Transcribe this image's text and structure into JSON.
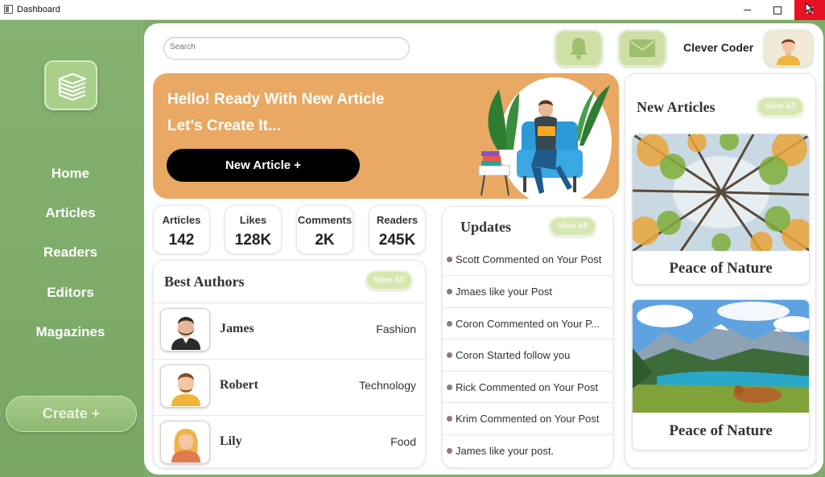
{
  "window": {
    "title": "Dashboard"
  },
  "sidebar": {
    "logo_icon": "stacked-books-icon",
    "nav": [
      "Home",
      "Articles",
      "Readers",
      "Editors",
      "Magazines"
    ],
    "create_label": "Create +"
  },
  "header": {
    "search_placeholder": "Search",
    "notification_icon": "bell-icon",
    "mail_icon": "mail-icon",
    "user_name": "Clever Coder"
  },
  "hero": {
    "line1": "Hello! Ready With New Article",
    "line2": "Let's Create It...",
    "button_label": "New Article +"
  },
  "stats": [
    {
      "label": "Articles",
      "value": "142"
    },
    {
      "label": "Likes",
      "value": "128K"
    },
    {
      "label": "Comments",
      "value": "2K"
    },
    {
      "label": "Readers",
      "value": "245K"
    }
  ],
  "best_authors": {
    "title": "Best Authors",
    "view_all": "View All",
    "items": [
      {
        "name": "James",
        "category": "Fashion"
      },
      {
        "name": "Robert",
        "category": "Technology"
      },
      {
        "name": "Lily",
        "category": "Food"
      }
    ]
  },
  "updates": {
    "title": "Updates",
    "view_all": "View All",
    "items": [
      "Scott Commented on Your Post",
      "Jmaes like your Post",
      "Coron Commented on Your P...",
      "Coron Started follow you",
      " Rick Commented on Your Post",
      "Krim Commented on Your Post",
      "James like your post."
    ]
  },
  "new_articles": {
    "title": "New Articles",
    "view_all": "View All",
    "items": [
      {
        "title": "Peace of Nature",
        "image": "forest-canopy"
      },
      {
        "title": "Peace of Nature",
        "image": "mountain-lake"
      }
    ]
  },
  "colors": {
    "sidebar": "#7fab6b",
    "hero": "#e9a863",
    "accent_button": "#cfe0a7",
    "close_button": "#e81123"
  }
}
